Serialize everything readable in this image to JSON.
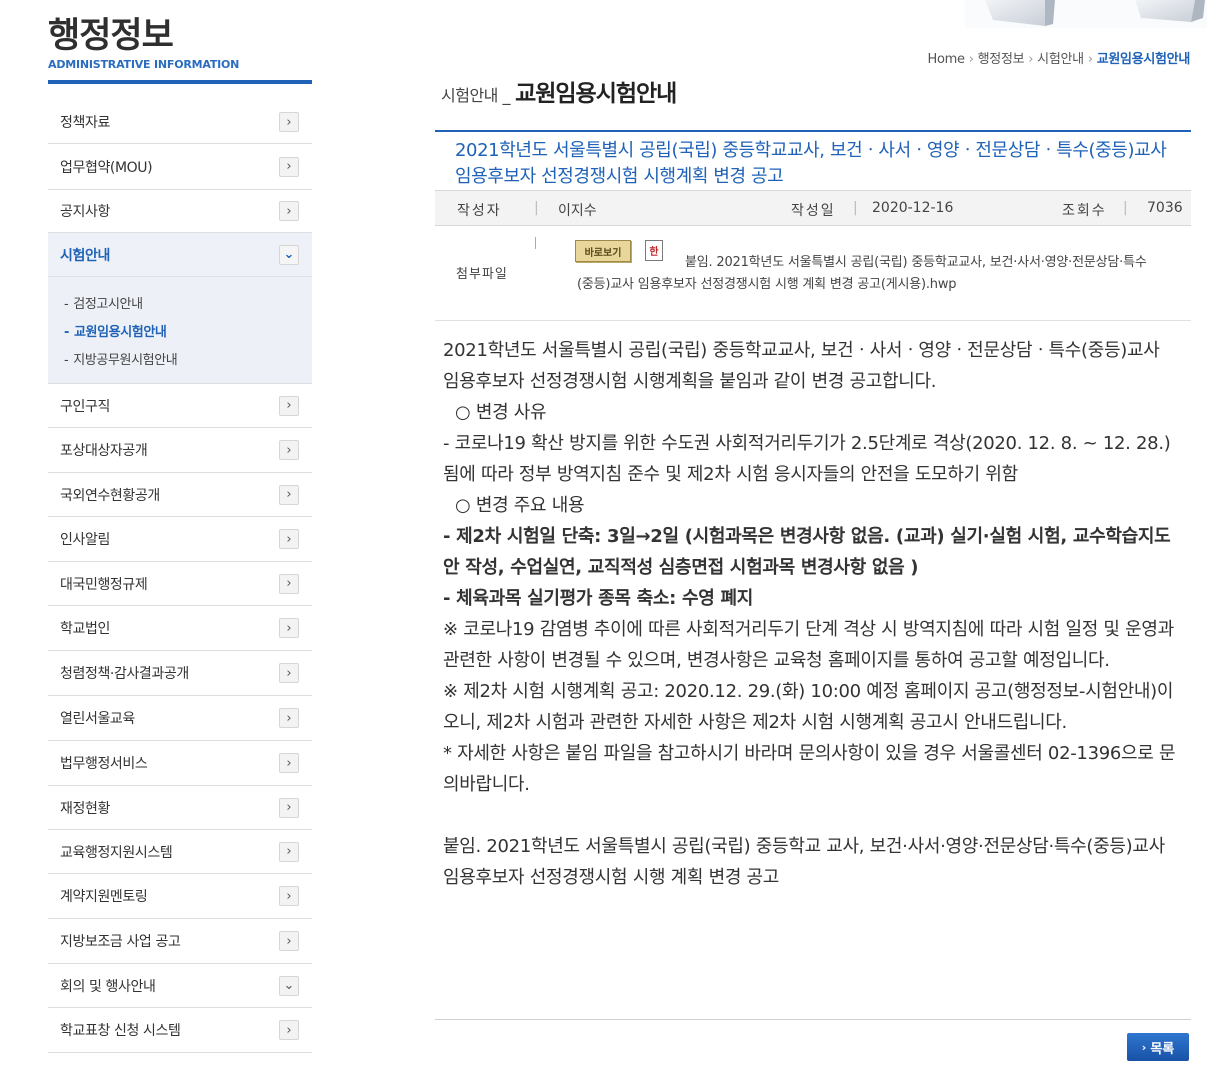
{
  "sidebar": {
    "title": "행정정보",
    "subtitle": "ADMINISTRATIVE INFORMATION",
    "items": [
      {
        "label": "정책자료"
      },
      {
        "label": "업무협약(MOU)"
      },
      {
        "label": "공지사항"
      },
      {
        "label": "시험안내"
      },
      {
        "label": "구인구직"
      },
      {
        "label": "포상대상자공개"
      },
      {
        "label": "국외연수현황공개"
      },
      {
        "label": "인사알림"
      },
      {
        "label": "대국민행정규제"
      },
      {
        "label": "학교법인"
      },
      {
        "label": "청렴정책·감사결과공개"
      },
      {
        "label": "열린서울교육"
      },
      {
        "label": "법무행정서비스"
      },
      {
        "label": "재정현황"
      },
      {
        "label": "교육행정지원시스템"
      },
      {
        "label": "계약지원멘토링"
      },
      {
        "label": "지방보조금 사업 공고"
      },
      {
        "label": "회의 및 행사안내"
      },
      {
        "label": "학교표창 신청 시스템"
      }
    ],
    "submenu": [
      {
        "label": "검정고시안내"
      },
      {
        "label": "교원임용시험안내"
      },
      {
        "label": "지방공무원시험안내"
      }
    ]
  },
  "breadcrumb": {
    "home": "Home",
    "level1": "행정정보",
    "level2": "시험안내",
    "current": "교원임용시험안내"
  },
  "heading": {
    "prefix": "시험안내 _",
    "title": "교원임용시험안내"
  },
  "article": {
    "title": "2021학년도 서울특별시 공립(국립) 중등학교교사, 보건ㆍ사서ㆍ영양ㆍ전문상담ㆍ특수(중등)교사 임용후보자 선정경쟁시험 시행계획 변경 공고",
    "author_label": "작성자",
    "author": "이지수",
    "date_label": "작성일",
    "date": "2020-12-16",
    "views_label": "조회수",
    "views": "7036",
    "attach_label": "첨부파일",
    "view_button": "바로보기",
    "file_name": "붙임. 2021학년도 서울특별시 공립(국립) 중등학교교사, 보건·사서·영양·전문상담·특수(중등)교사 임용후보자 선정경쟁시험 시행 계획 변경 공고(게시용).hwp",
    "body": {
      "p1": "2021학년도 서울특별시 공립(국립) 중등학교교사, 보건ㆍ사서ㆍ영양ㆍ전문상담ㆍ특수(중등)교사 임용후보자 선정경쟁시험 시행계획을 붙임과 같이 변경 공고합니다.",
      "p2": "○ 변경 사유",
      "p3": " - 코로나19 확산 방지를 위한 수도권 사회적거리두기가 2.5단계로 격상(2020. 12. 8. ~ 12. 28.)됨에 따라 정부 방역지침 준수 및 제2차 시험 응시자들의 안전을 도모하기 위함",
      "p4": "○ 변경 주요 내용",
      "p5": "- 제2차 시험일 단축: 3일→2일 (시험과목은 변경사항 없음. (교과) 실기·실험 시험, 교수학습지도안 작성, 수업실연, 교직적성 심층면접 시험과목 변경사항 없음 )",
      "p6": "- 체육과목 실기평가 종목 축소: 수영 폐지",
      "p7": "※ 코로나19 감염병 추이에 따른 사회적거리두기 단계 격상 시 방역지침에 따라 시험 일정 및 운영과 관련한 사항이 변경될 수 있으며, 변경사항은 교육청 홈페이지를 통하여 공고할 예정입니다.",
      "p8": "※ 제2차 시험 시행계획 공고: 2020.12. 29.(화) 10:00 예정 홈페이지 공고(행정정보-시험안내)이오니, 제2차 시험과 관련한  자세한 사항은 제2차 시험 시행계획 공고시 안내드립니다.",
      "p9": "* 자세한 사항은 붙임 파일을 참고하시기 바라며 문의사항이 있을 경우 서울콜센터 02-1396으로 문의바랍니다.",
      "p10": "붙임. 2021학년도 서울특별시 공립(국립) 중등학교 교사, 보건·사서·영양·전문상담·특수(중등)교사 임용후보자 선정경쟁시험 시행 계획 변경 공고"
    }
  },
  "list_button": "목록",
  "colors": {
    "accent": "#1f62b8",
    "text": "#333333",
    "meta_bg": "#f3f3f3"
  }
}
